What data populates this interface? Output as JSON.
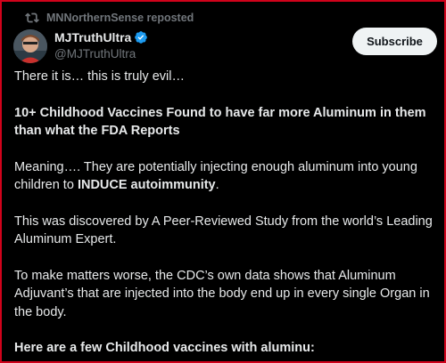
{
  "repost": {
    "text": "MNNorthernSense reposted",
    "icon": "repost-icon"
  },
  "author": {
    "display_name": "MJTruthUltra",
    "handle": "@MJTruthUltra",
    "verified_icon": "verified-badge-icon",
    "verified_color": "#1d9bf0"
  },
  "subscribe_label": "Subscribe",
  "post": {
    "line1": "There it is… this is truly evil…",
    "headline": "10+ Childhood Vaccines Found to have far more Aluminum in them than what the FDA Reports",
    "meaning_pre": "Meaning…. They are potentially injecting enough aluminum into young children to ",
    "meaning_bold": "INDUCE autoimmunity",
    "meaning_post": ".",
    "discovered": "This was discovered by A Peer-Reviewed Study from the world’s Leading Aluminum Expert.",
    "worse": "To make matters worse, the CDC’s own data shows that Aluminum Adjuvant’s that are injected into the body end up in every single Organ in the body.",
    "list_heading": "Here are a few Childhood vaccines with aluminu:"
  },
  "colors": {
    "frame_border": "#d0021b",
    "background": "#000000",
    "text": "#e7e9ea",
    "secondary_text": "#71767b",
    "button_bg": "#eff3f4"
  }
}
